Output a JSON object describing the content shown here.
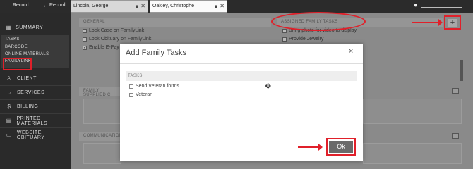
{
  "topbar": {
    "record_prev_label": "Record",
    "record_next_label": "Record"
  },
  "tabs": [
    {
      "label": "Lincoln, George"
    },
    {
      "label": "Oakley, Christophe"
    }
  ],
  "sidebar": {
    "summary_label": "SUMMARY",
    "subitems": [
      "TASKS",
      "BARCODE",
      "ONLINE MATERIALS",
      "FAMILYLINK"
    ],
    "nav": [
      {
        "label": "CLIENT",
        "icon": "user-icon"
      },
      {
        "label": "SERVICES",
        "icon": "circle-icon"
      },
      {
        "label": "BILLING",
        "icon": "dollar-icon"
      },
      {
        "label": "PRINTED MATERIALS",
        "icon": "document-icon"
      },
      {
        "label": "WEBSITE OBITUARY",
        "icon": "monitor-icon"
      }
    ]
  },
  "main": {
    "general_head": "GENERAL",
    "general_items": [
      {
        "label": "Lock Case on FamilyLink",
        "checked": false
      },
      {
        "label": "Lock Obituary on FamilyLink",
        "checked": false
      },
      {
        "label": "Enable E-Pay",
        "checked": true
      }
    ],
    "assigned_head": "ASSIGNED FAMILY TASKS",
    "assigned_items": [
      {
        "label": "Bring photo for video to display"
      },
      {
        "label": "Provide Jewelry"
      }
    ],
    "family_supplied_head": "FAMILY SUPPLIED C",
    "communication_head": "COMMUNICATION"
  },
  "modal": {
    "title": "Add Family Tasks",
    "close": "×",
    "tasks_head": "TASKS",
    "tasks": [
      {
        "label": "Send Veteran forms",
        "checked": false
      },
      {
        "label": "Veteran",
        "checked": false
      }
    ],
    "ok_label": "Ok"
  },
  "colors": {
    "annotation": "#e0202a",
    "sidebar_bg": "#2a2a2a",
    "ok_button": "#6a6a6a"
  }
}
